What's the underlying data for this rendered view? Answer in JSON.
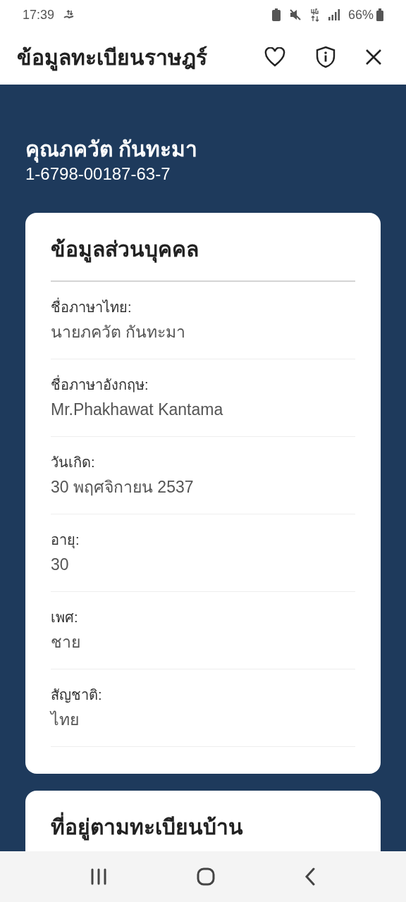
{
  "status_bar": {
    "time": "17:39",
    "battery": "66%"
  },
  "header": {
    "title": "ข้อมูลทะเบียนราษฎร์"
  },
  "person": {
    "name": "คุณภควัต กันทะมา",
    "id_number": "1-6798-00187-63-7"
  },
  "sections": [
    {
      "title": "ข้อมูลส่วนบุคคล",
      "fields": [
        {
          "label": "ชื่อภาษาไทย:",
          "value": "นายภควัต กันทะมา"
        },
        {
          "label": "ชื่อภาษาอังกฤษ:",
          "value": "Mr.Phakhawat Kantama"
        },
        {
          "label": "วันเกิด:",
          "value": "30 พฤศจิกายน 2537"
        },
        {
          "label": "อายุ:",
          "value": "30"
        },
        {
          "label": "เพศ:",
          "value": "ชาย"
        },
        {
          "label": "สัญชาติ:",
          "value": "ไทย"
        }
      ]
    },
    {
      "title": "ที่อยู่ตามทะเบียนบ้าน"
    }
  ]
}
